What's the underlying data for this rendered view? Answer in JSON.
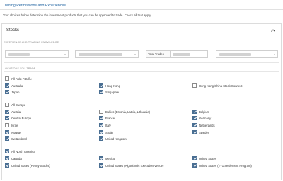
{
  "page": {
    "title": "Trading Permissions and Experiences",
    "intro": "Your choices below determine the investment products that you can be approved to trade. Check all that apply."
  },
  "panel": {
    "title": "Stocks",
    "experience_label": "EXPERIENCE AND TRADING KNOWLEDGE",
    "total_trades_label": "Total Trades",
    "locations_label": "LOCATIONS YOU TRADE"
  },
  "regions": [
    {
      "name": "All Asia Pacific",
      "checked": false,
      "items": [
        {
          "label": "Australia",
          "checked": true
        },
        {
          "label": "Hong Kong",
          "checked": true
        },
        {
          "label": "Hong Kong/China Stock Connect",
          "checked": false
        },
        {
          "label": "Japan",
          "checked": true
        },
        {
          "label": "Singapore",
          "checked": true
        }
      ]
    },
    {
      "name": "All Europe",
      "checked": false,
      "items": [
        {
          "label": "Austria",
          "checked": true
        },
        {
          "label": "Baltics (Estonia, Latvia, Lithuania)",
          "checked": false
        },
        {
          "label": "Belgium",
          "checked": true
        },
        {
          "label": "Central Europe",
          "checked": true
        },
        {
          "label": "France",
          "checked": true
        },
        {
          "label": "Germany",
          "checked": true
        },
        {
          "label": "Israel",
          "checked": false
        },
        {
          "label": "Italy",
          "checked": true
        },
        {
          "label": "Netherlands",
          "checked": true
        },
        {
          "label": "Norway",
          "checked": true
        },
        {
          "label": "Spain",
          "checked": true
        },
        {
          "label": "Sweden",
          "checked": true
        },
        {
          "label": "Switzerland",
          "checked": true
        },
        {
          "label": "United Kingdom",
          "checked": true
        }
      ]
    },
    {
      "name": "All North America",
      "checked": true,
      "items": [
        {
          "label": "Canada",
          "checked": true
        },
        {
          "label": "Mexico",
          "checked": true
        },
        {
          "label": "United States",
          "checked": true
        },
        {
          "label": "United States (Penny Stocks)",
          "checked": true
        },
        {
          "label": "United States (Algorithmic Execution Venue)",
          "checked": true
        },
        {
          "label": "United States (T+1 Settlement Program)",
          "checked": true
        }
      ]
    }
  ]
}
